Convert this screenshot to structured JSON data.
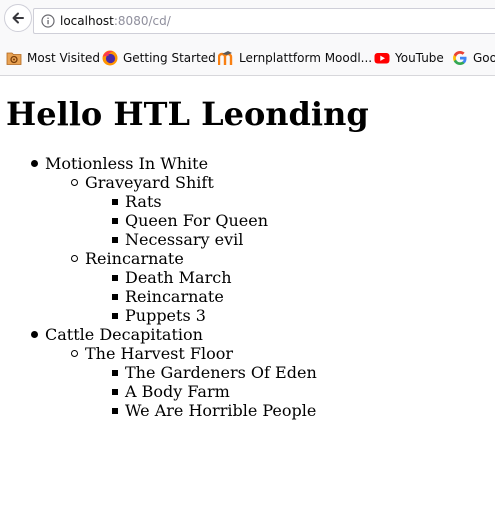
{
  "browser": {
    "url_host": "localhost",
    "url_rest": ":8080/cd/",
    "bookmarks": [
      {
        "label": "Most Visited",
        "icon": "folder-gear-icon"
      },
      {
        "label": "Getting Started",
        "icon": "firefox-icon"
      },
      {
        "label": "Lernplattform Moodl...",
        "icon": "moodle-icon"
      },
      {
        "label": "YouTube",
        "icon": "youtube-icon"
      },
      {
        "label": "Goo",
        "icon": "google-icon"
      }
    ]
  },
  "page": {
    "title": "Hello HTL Leonding",
    "bands": [
      {
        "name": "Motionless In White",
        "albums": [
          {
            "name": "Graveyard Shift",
            "tracks": [
              "Rats",
              "Queen For Queen",
              "Necessary evil"
            ]
          },
          {
            "name": "Reincarnate",
            "tracks": [
              "Death March",
              "Reincarnate",
              "Puppets 3"
            ]
          }
        ]
      },
      {
        "name": "Cattle Decapitation",
        "albums": [
          {
            "name": "The Harvest Floor",
            "tracks": [
              "The Gardeners Of Eden",
              "A Body Farm",
              "We Are Horrible People"
            ]
          }
        ]
      }
    ]
  }
}
